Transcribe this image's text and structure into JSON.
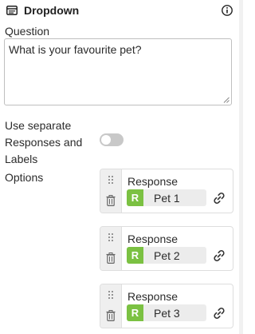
{
  "panel": {
    "title": "Dropdown",
    "icons": {
      "header": "dropdown-panel-icon",
      "info": "info-icon"
    }
  },
  "question": {
    "label": "Question",
    "value": "What is your favourite pet?"
  },
  "separate_toggle": {
    "label": "Use separate Responses and Labels",
    "checked": false
  },
  "options": {
    "label": "Options",
    "items": [
      {
        "title": "Response",
        "badge": "R",
        "value": "Pet 1"
      },
      {
        "title": "Response",
        "badge": "R",
        "value": "Pet 2"
      },
      {
        "title": "Response",
        "badge": "R",
        "value": "Pet 3"
      }
    ]
  },
  "colors": {
    "badge": "#7bc142",
    "toggle_off": "#c8c8c8",
    "handle_bg": "#efefef"
  }
}
